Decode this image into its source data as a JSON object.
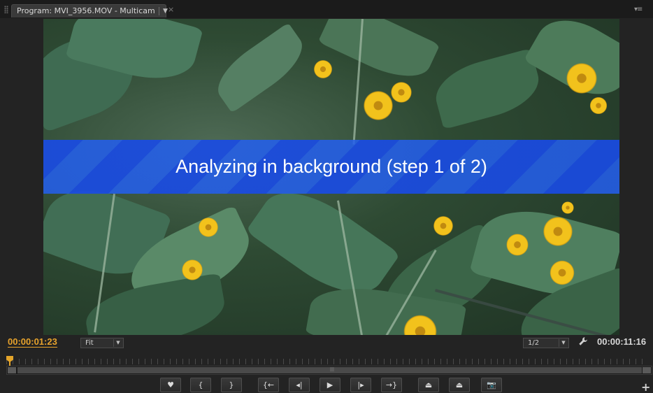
{
  "panel": {
    "tab_title": "Program: MVI_3956.MOV - Multicam",
    "tab_dropdown_icon": "chevron-down-icon",
    "close_glyph": "×",
    "menu_glyph": "▾≡"
  },
  "overlay": {
    "message": "Analyzing in background (step 1 of 2)"
  },
  "controls": {
    "current_timecode": "00:00:01:23",
    "zoom_value": "Fit",
    "resolution_value": "1/2",
    "duration_timecode": "00:00:11:16",
    "arrow_glyph": "▼",
    "scroll_grip_glyph": "|||"
  },
  "transport": {
    "buttons": [
      {
        "name": "add-marker",
        "glyph": "♥"
      },
      {
        "name": "mark-in",
        "glyph": "{"
      },
      {
        "name": "mark-out",
        "glyph": "}"
      },
      {
        "name": "go-to-in",
        "glyph": "{←"
      },
      {
        "name": "step-back",
        "glyph": "◂|"
      },
      {
        "name": "play-stop",
        "glyph": "▶"
      },
      {
        "name": "step-forward",
        "glyph": "|▸"
      },
      {
        "name": "go-to-out",
        "glyph": "→}"
      },
      {
        "name": "lift",
        "glyph": "⏏"
      },
      {
        "name": "extract",
        "glyph": "⏏"
      },
      {
        "name": "export-frame",
        "glyph": "📷"
      }
    ],
    "add_glyph": "+"
  },
  "colors": {
    "timecode_accent": "#e8a32c",
    "overlay_band": "#1e4ee8",
    "panel_bg": "#232323"
  }
}
